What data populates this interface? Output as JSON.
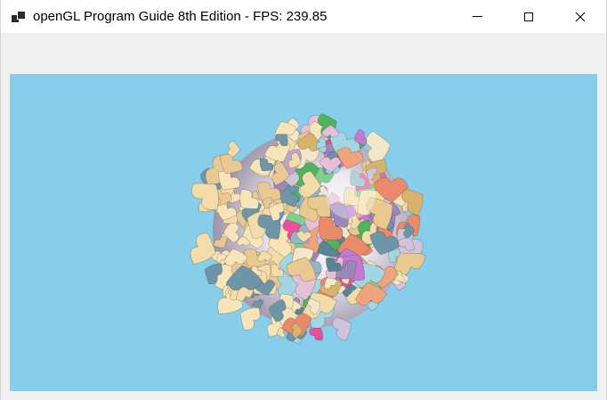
{
  "window": {
    "title": "openGL Program Guide 8th Edition - FPS: 239.85",
    "icon": "app-window-icon"
  },
  "controls": {
    "minimize_icon": "minimize-icon",
    "maximize_icon": "maximize-icon",
    "close_icon": "close-icon"
  },
  "viewport": {
    "background_color": "#87ceeb",
    "content": "rendered-3d-sphere-of-colored-shapes"
  }
}
